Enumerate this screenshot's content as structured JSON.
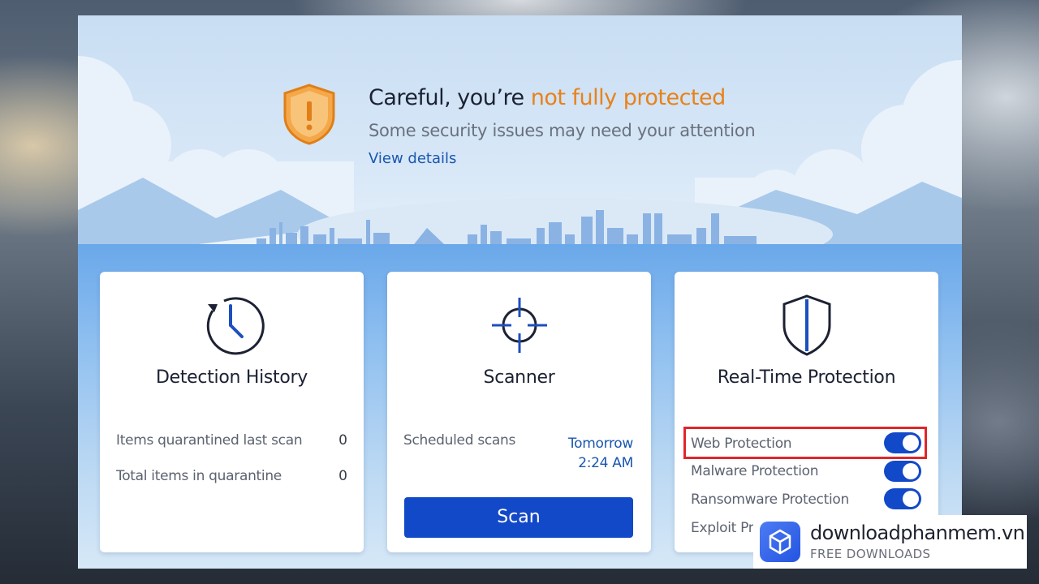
{
  "alert": {
    "title_prefix": "Careful, you’re",
    "title_emphasis": "not fully protected",
    "subtitle": "Some security issues may need your attention",
    "link": "View details"
  },
  "cards": {
    "detection_history": {
      "title": "Detection History",
      "rows": [
        {
          "label": "Items quarantined last scan",
          "value": "0"
        },
        {
          "label": "Total items in quarantine",
          "value": "0"
        }
      ]
    },
    "scanner": {
      "title": "Scanner",
      "scheduled_label": "Scheduled scans",
      "scheduled_day": "Tomorrow",
      "scheduled_time": "2:24 AM",
      "scan_button": "Scan"
    },
    "realtime": {
      "title": "Real-Time Protection",
      "items": [
        {
          "label": "Web Protection",
          "enabled": true
        },
        {
          "label": "Malware Protection",
          "enabled": true
        },
        {
          "label": "Ransomware Protection",
          "enabled": true
        },
        {
          "label": "Exploit Pr",
          "enabled": true
        }
      ]
    }
  },
  "watermark": {
    "title": "downloadphanmem.vn",
    "subtitle": "FREE DOWNLOADS"
  },
  "colors": {
    "accent": "#1249c8",
    "warning": "#e8821a",
    "link": "#1a56b0",
    "highlight": "#e0262b"
  }
}
